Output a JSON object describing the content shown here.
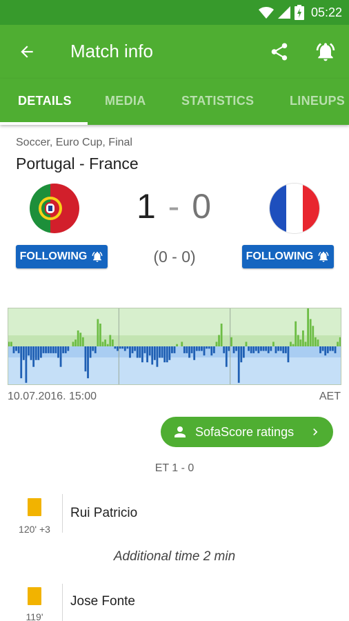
{
  "status_bar": {
    "time": "05:22",
    "icons": [
      "wifi-icon",
      "cell-signal-icon",
      "battery-charging-icon"
    ]
  },
  "app_bar": {
    "title": "Match info",
    "icons": [
      "back-arrow-icon",
      "share-icon",
      "notification-bell-icon"
    ]
  },
  "tabs": [
    {
      "label": "DETAILS",
      "active": true
    },
    {
      "label": "MEDIA",
      "active": false
    },
    {
      "label": "STATISTICS",
      "active": false
    },
    {
      "label": "LINEUPS",
      "active": false
    }
  ],
  "match": {
    "meta": "Soccer, Euro Cup, Final",
    "name": "Portugal - France",
    "home_score": "1",
    "separator": "-",
    "away_score": "0",
    "halftime": "(0 - 0)",
    "follow_home_label": "FOLLOWING",
    "follow_away_label": "FOLLOWING"
  },
  "graph": {
    "date": "10.07.2016. 15:00",
    "status": "AET",
    "periods": 3,
    "home_color": "#6dbd45",
    "away_color": "#1f5fb3",
    "momentum": [
      2,
      2,
      -3,
      -2,
      -3,
      -14,
      -6,
      -16,
      -4,
      -6,
      -9,
      -6,
      -6,
      -5,
      -3,
      -3,
      -3,
      -3,
      -3,
      -3,
      -5,
      -9,
      -3,
      -3,
      -2,
      0,
      2,
      3,
      7,
      6,
      4,
      -11,
      -14,
      -5,
      -2,
      -3,
      12,
      10,
      2,
      3,
      1,
      5,
      3,
      -1,
      -2,
      -1,
      -1,
      -2,
      -1,
      -5,
      -3,
      -2,
      -5,
      -5,
      -7,
      -3,
      -7,
      -4,
      -8,
      -6,
      -9,
      -5,
      -5,
      -7,
      -7,
      -6,
      -3,
      -3,
      1,
      0,
      2,
      -3,
      -3,
      -5,
      -3,
      -6,
      -2,
      -2,
      -2,
      -4,
      -1,
      -1,
      -4,
      -3,
      2,
      5,
      10,
      -3,
      -9,
      -2,
      4,
      -3,
      -2,
      -16,
      -7,
      -5,
      2,
      -2,
      -3,
      -3,
      -2,
      -3,
      -2,
      -2,
      -2,
      -3,
      -2,
      2,
      -3,
      -2,
      -2,
      -3,
      -3,
      -7,
      2,
      1,
      11,
      5,
      3,
      7,
      2,
      17,
      12,
      9,
      4,
      3,
      -3,
      -2,
      -4,
      -3,
      -2,
      -2,
      -3,
      2,
      4
    ]
  },
  "ratings_button": {
    "label": "SofaScore ratings"
  },
  "et_score": "ET 1 - 0",
  "events": [
    {
      "time": "120' +3",
      "player": "Rui Patricio",
      "card": "yellow"
    },
    {
      "time": "119'",
      "player": "Jose Fonte",
      "card": "yellow"
    }
  ],
  "additional_time": "Additional time 2 min",
  "colors": {
    "primary": "#4fae32",
    "primary_dark": "#379a2c",
    "follow_blue": "#1565c0",
    "card_yellow": "#f2b300"
  }
}
